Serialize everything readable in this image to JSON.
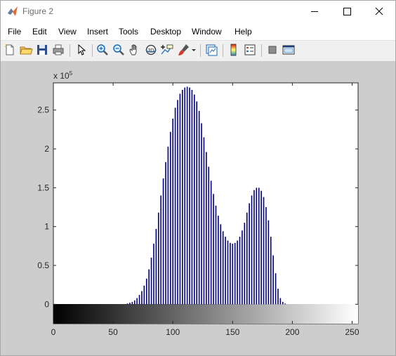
{
  "window": {
    "title": "Figure 2",
    "controls": [
      "minimize",
      "maximize",
      "close"
    ]
  },
  "menu": [
    "File",
    "Edit",
    "View",
    "Insert",
    "Tools",
    "Desktop",
    "Window",
    "Help"
  ],
  "toolbar": [
    {
      "name": "new-figure-icon"
    },
    {
      "name": "open-file-icon"
    },
    {
      "name": "save-icon"
    },
    {
      "name": "print-icon"
    },
    {
      "name": "separator"
    },
    {
      "name": "pointer-icon"
    },
    {
      "name": "separator"
    },
    {
      "name": "zoom-in-icon"
    },
    {
      "name": "zoom-out-icon"
    },
    {
      "name": "pan-icon"
    },
    {
      "name": "rotate-3d-icon"
    },
    {
      "name": "data-cursor-icon"
    },
    {
      "name": "brush-icon"
    },
    {
      "name": "brush-dropdown-icon"
    },
    {
      "name": "separator"
    },
    {
      "name": "link-plot-icon"
    },
    {
      "name": "separator"
    },
    {
      "name": "colorbar-icon"
    },
    {
      "name": "legend-icon"
    },
    {
      "name": "separator"
    },
    {
      "name": "hide-plot-tools-icon"
    },
    {
      "name": "show-plot-tools-icon"
    }
  ],
  "colors": {
    "bars": "#00007f",
    "figure_bg": "#cdcdcd",
    "axes_bg": "#ffffff"
  },
  "chart_data": {
    "type": "bar",
    "title": "",
    "xlabel": "",
    "ylabel": "",
    "y_exponent_label": "x 10^5",
    "xlim": [
      0,
      255
    ],
    "ylim": [
      -0.25,
      2.85
    ],
    "xticks": [
      0,
      50,
      100,
      150,
      200,
      250
    ],
    "yticks": [
      0,
      0.5,
      1,
      1.5,
      2,
      2.5
    ],
    "ytick_labels": [
      "0",
      "0.5",
      "1",
      "1.5",
      "2",
      "2.5"
    ],
    "x_colorbar": "grayscale 0-255",
    "series": [
      {
        "x": [
          60,
          62,
          64,
          66,
          68,
          70,
          72,
          74,
          76,
          78,
          80,
          82,
          84,
          86,
          88,
          90,
          92,
          94,
          96,
          98,
          100,
          102,
          104,
          106,
          108,
          110,
          112,
          114,
          116,
          118,
          120,
          122,
          124,
          126,
          128,
          130,
          132,
          134,
          136,
          138,
          140,
          142,
          144,
          146,
          148,
          150,
          152,
          154,
          156,
          158,
          160,
          162,
          164,
          166,
          168,
          170,
          172,
          174,
          176,
          178,
          180,
          182,
          184,
          186,
          188,
          190,
          192,
          194,
          196,
          198,
          200,
          202,
          204,
          206
        ],
        "values": [
          0.0,
          0.01,
          0.02,
          0.03,
          0.05,
          0.08,
          0.12,
          0.17,
          0.24,
          0.33,
          0.45,
          0.6,
          0.78,
          0.97,
          1.18,
          1.4,
          1.62,
          1.83,
          2.03,
          2.22,
          2.39,
          2.53,
          2.63,
          2.71,
          2.76,
          2.79,
          2.8,
          2.79,
          2.76,
          2.7,
          2.61,
          2.49,
          2.33,
          2.15,
          1.96,
          1.77,
          1.59,
          1.42,
          1.27,
          1.14,
          1.03,
          0.94,
          0.87,
          0.82,
          0.79,
          0.78,
          0.79,
          0.82,
          0.87,
          0.95,
          1.05,
          1.18,
          1.3,
          1.4,
          1.47,
          1.5,
          1.5,
          1.46,
          1.38,
          1.25,
          1.08,
          0.87,
          0.63,
          0.4,
          0.2,
          0.08,
          0.03,
          0.01,
          0.0,
          0.0,
          0.0,
          0.0,
          0.0,
          0.0
        ]
      }
    ]
  }
}
